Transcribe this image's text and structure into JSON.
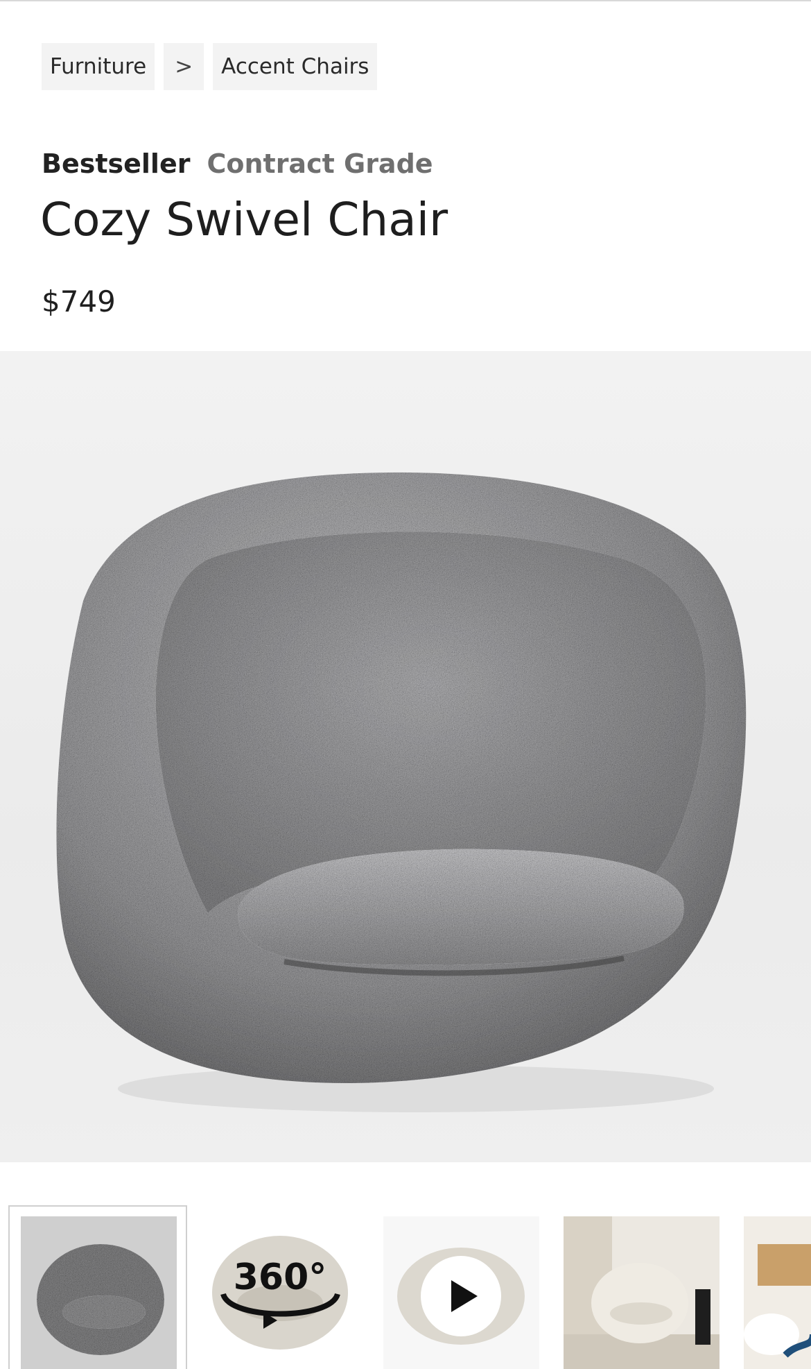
{
  "breadcrumb": {
    "items": [
      {
        "label": "Furniture"
      },
      {
        "label": ">"
      },
      {
        "label": "Accent Chairs"
      }
    ]
  },
  "product": {
    "badges": [
      "Bestseller",
      "Contract Grade"
    ],
    "title": "Cozy Swivel Chair",
    "price": "$749"
  },
  "gallery": {
    "hero_alt": "gray tweed swivel chair",
    "thumbnails": [
      {
        "name": "gray-chair-thumb",
        "selected": true
      },
      {
        "name": "360-view-thumb",
        "overlay": "360°"
      },
      {
        "name": "video-thumb",
        "overlay": "play-icon"
      },
      {
        "name": "room-scene-thumb"
      },
      {
        "name": "room-scene-2-thumb"
      }
    ]
  },
  "colors": {
    "fabric_dark": "#6e6e6e",
    "fabric_light": "#a8a8a8",
    "cream_fabric": "#d9d5cc"
  }
}
